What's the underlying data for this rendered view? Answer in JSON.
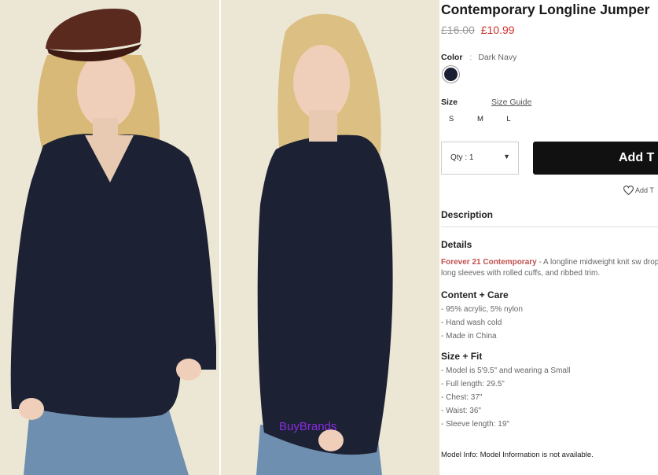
{
  "watermark": "BuyBrands",
  "product": {
    "title": "Contemporary Longline Jumper",
    "old_price": "£16.00",
    "new_price": "£10.99"
  },
  "color": {
    "label": "Color",
    "separator": ":",
    "value": "Dark Navy",
    "swatch_color": "#1b1f33"
  },
  "size": {
    "label": "Size",
    "guide": "Size Guide",
    "options": [
      "S",
      "M",
      "L"
    ]
  },
  "qty": {
    "label": "Qty : 1",
    "caret": "▼"
  },
  "add_button": "Add T",
  "wishlist": "Add T",
  "description": {
    "heading": "Description"
  },
  "details": {
    "heading": "Details",
    "brand": "Forever 21 Contemporary",
    "text": " - A longline midweight knit sw dropped long sleeves with rolled cuffs, and ribbed trim."
  },
  "content_care": {
    "heading": "Content + Care",
    "items": [
      "- 95% acrylic, 5% nylon",
      "- Hand wash cold",
      "- Made in China"
    ]
  },
  "size_fit": {
    "heading": "Size + Fit",
    "items": [
      "- Model is 5'9.5\" and wearing a Small",
      "- Full length: 29.5\"",
      "- Chest: 37\"",
      "- Waist: 36\"",
      "- Sleeve length: 19\""
    ]
  },
  "model_info": "Model Info: Model Information is not available.",
  "colors": {
    "accent_price": "#d0312d",
    "brand_link": "#c0504d",
    "button": "#111111",
    "sweater": "#1c2233",
    "backdrop": "#ebe6d3"
  }
}
